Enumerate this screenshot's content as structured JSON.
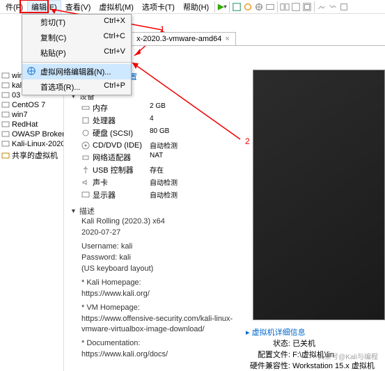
{
  "menubar": {
    "file": "件(F)",
    "edit": "编辑(E)",
    "view": "查看(V)",
    "vm": "虚拟机(M)",
    "tabs": "选项卡(T)",
    "help": "帮助(H)"
  },
  "dropdown": {
    "cut": "剪切(T)",
    "cut_k": "Ctrl+X",
    "copy": "复制(C)",
    "copy_k": "Ctrl+C",
    "paste": "粘贴(P)",
    "paste_k": "Ctrl+V",
    "vnet": "虚拟网络编辑器(N)...",
    "pref": "首选项(R)...",
    "pref_k": "Ctrl+P"
  },
  "tabs": {
    "t1": "...vmware-a...",
    "t2": "x-2020.3-vmware-amd64"
  },
  "editlink": "编辑虚拟机设置",
  "sidebar": {
    "items": [
      "win10",
      "kali",
      "03",
      "CentOS 7",
      "win7",
      "RedHat",
      "OWASP Broken",
      "Kali-Linux-2020",
      "共享的虚拟机"
    ]
  },
  "devices": {
    "header": "设备",
    "mem_l": "内存",
    "mem_v": "2 GB",
    "cpu_l": "处理器",
    "cpu_v": "4",
    "hdd_l": "硬盘 (SCSI)",
    "hdd_v": "80 GB",
    "cd_l": "CD/DVD (IDE)",
    "cd_v": "自动检测",
    "net_l": "网络适配器",
    "net_v": "NAT",
    "usb_l": "USB 控制器",
    "usb_v": "存在",
    "snd_l": "声卡",
    "snd_v": "自动检测",
    "dsp_l": "显示器",
    "dsp_v": "自动检测"
  },
  "desc": {
    "header": "描述",
    "l1": "Kali Rolling (2020.3) x64",
    "l2": "2020-07-27",
    "l3": "Username: kali",
    "l4": "Password: kali",
    "l5": "(US keyboard layout)",
    "l6": "* Kali Homepage:",
    "l7": "https://www.kali.org/",
    "l8": "* VM Homepage:",
    "l9": "https://www.offensive-security.com/kali-linux-vmware-virtualbox-image-download/",
    "l10": "* Documentation:",
    "l11": "https://www.kali.org/docs/"
  },
  "details": {
    "header": "虚拟机详细信息",
    "state_l": "状态:",
    "state_v": "已关机",
    "cfg_l": "配置文件:",
    "cfg_v": "F:\\虚拟机\\lin",
    "compat_l": "硬件兼容性:",
    "compat_v": "Workstation 15.x 虚拟机"
  },
  "markers": {
    "m1": "1",
    "m2": "2"
  },
  "watermark": "头条号@Kali与编程"
}
